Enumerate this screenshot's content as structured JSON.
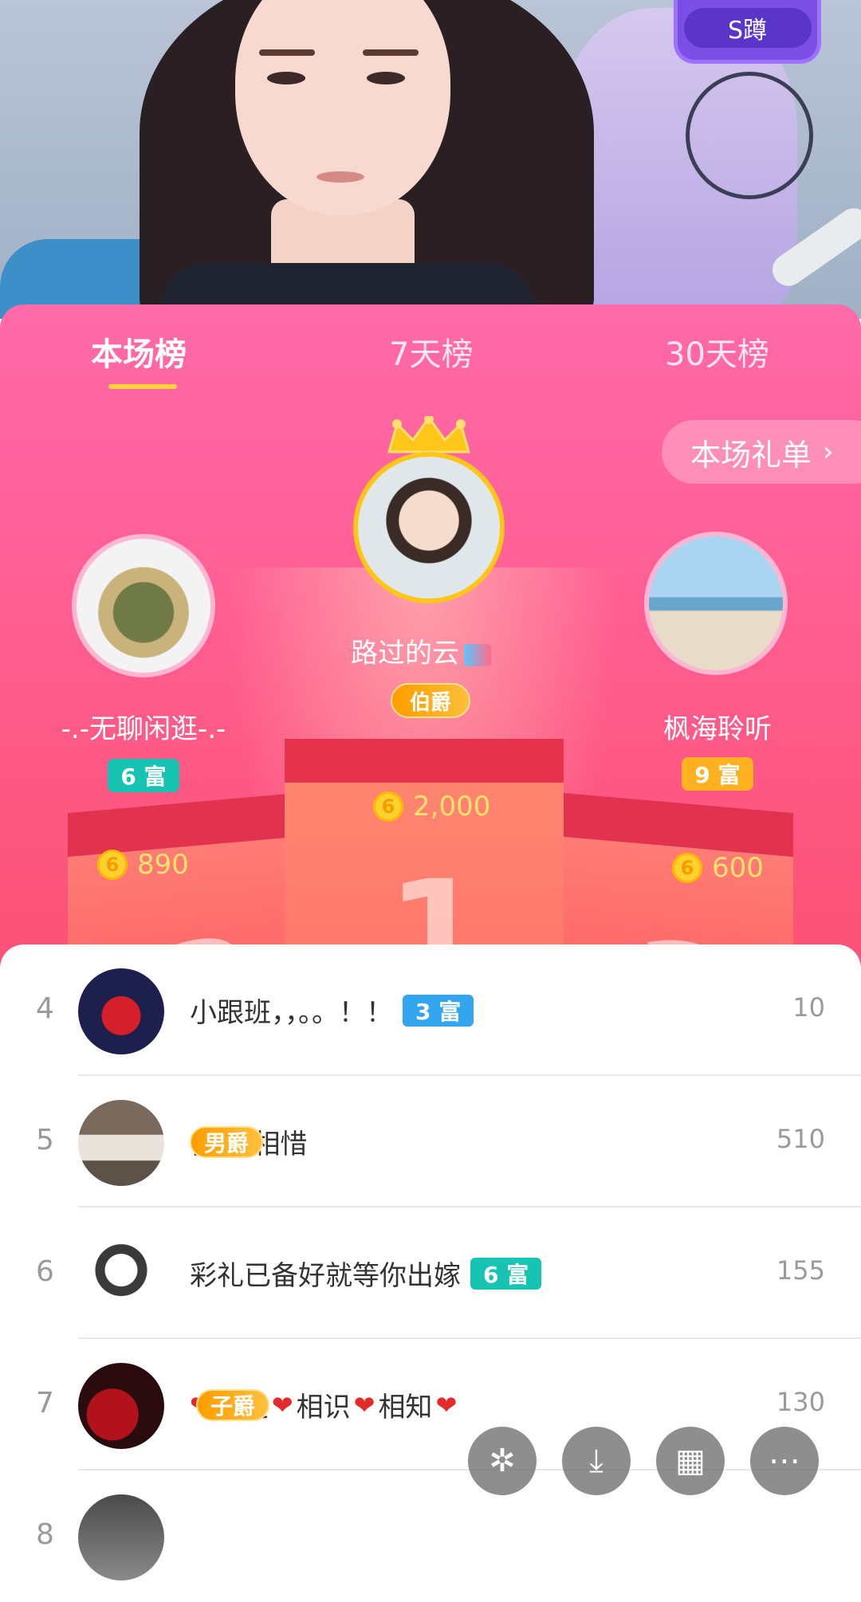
{
  "header": {
    "level_badge": "S蹲"
  },
  "tabs": [
    {
      "label": "本场榜",
      "active": true
    },
    {
      "label": "7天榜",
      "active": false
    },
    {
      "label": "30天榜",
      "active": false
    }
  ],
  "gift_list_button": {
    "label": "本场礼单",
    "chevron": "›"
  },
  "podium": {
    "first": {
      "name": "路过的云",
      "noble": "伯爵",
      "score": "2,000",
      "digit": "1"
    },
    "second": {
      "name": "-.-无聊闲逛-.-",
      "level": "6 富",
      "score": "890",
      "digit": "2"
    },
    "third": {
      "name": "枫海聆听",
      "level": "9 富",
      "score": "600",
      "digit": "3"
    }
  },
  "coin_symbol": "6",
  "list": [
    {
      "rank": "4",
      "name": "小跟班，，。。！！",
      "badge": "3 富",
      "badge_style": "blue",
      "value": "10"
    },
    {
      "rank": "5",
      "name": "彼此/相惜",
      "badge": "男爵",
      "badge_style": "noble",
      "value": "510"
    },
    {
      "rank": "6",
      "name": "彩礼已备好就等你出嫁",
      "badge": "6 富",
      "badge_style": "teal",
      "value": "155"
    },
    {
      "rank": "7",
      "name": "相遇",
      "name2": "相识",
      "name3": "相知",
      "badge": "子爵",
      "badge_style": "noble",
      "value": "130"
    },
    {
      "rank": "8",
      "name": "",
      "badge": "",
      "value": ""
    }
  ],
  "fab_buttons": [
    {
      "icon": "sparkle-icon",
      "glyph": "✲"
    },
    {
      "icon": "download-icon",
      "glyph": "⤓"
    },
    {
      "icon": "grid-icon",
      "glyph": "▦"
    },
    {
      "icon": "more-icon",
      "glyph": "⋯"
    }
  ],
  "colors": {
    "accent": "#ff5e92",
    "gold": "#ffd13b"
  }
}
